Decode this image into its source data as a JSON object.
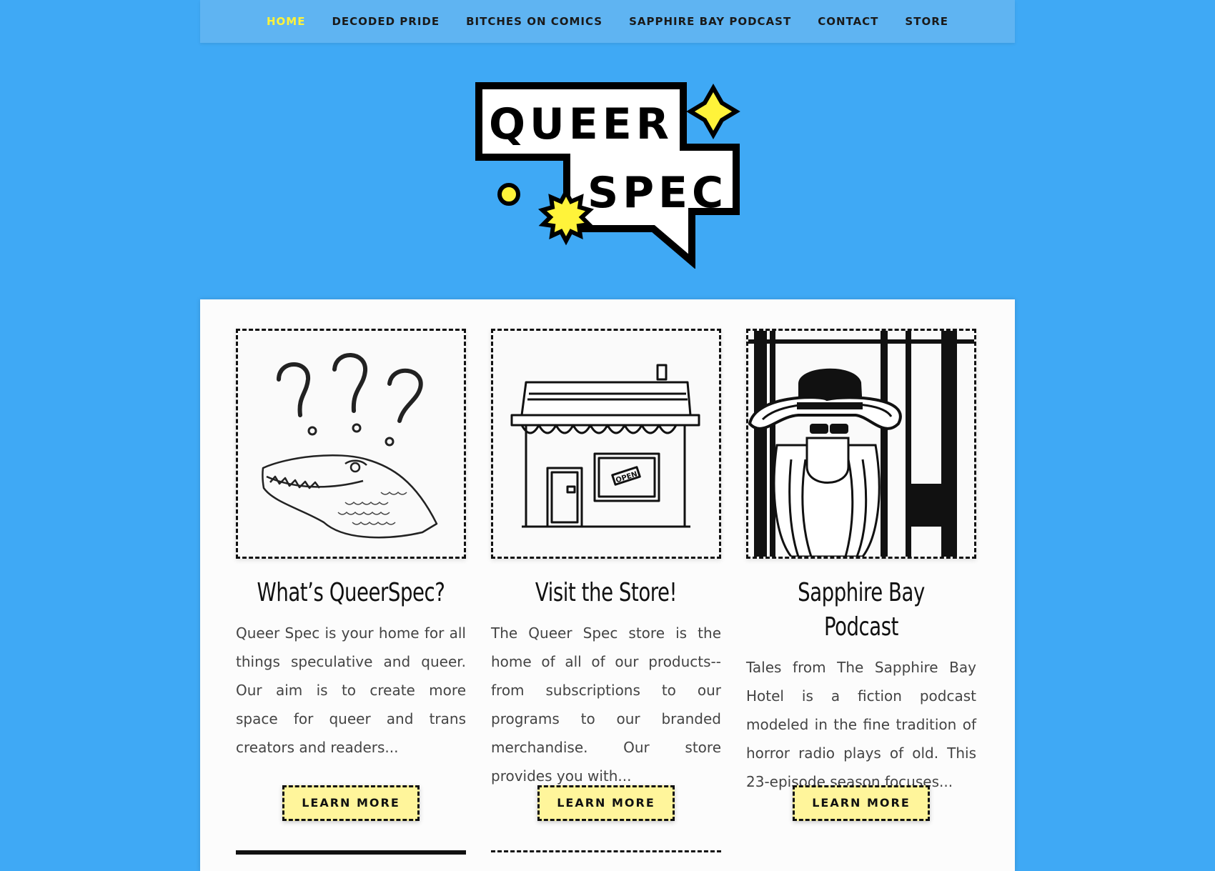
{
  "nav": {
    "items": [
      {
        "label": "HOME",
        "active": true
      },
      {
        "label": "DECODED PRIDE",
        "active": false
      },
      {
        "label": "BITCHES ON COMICS",
        "active": false
      },
      {
        "label": "SAPPHIRE BAY PODCAST",
        "active": false
      },
      {
        "label": "CONTACT",
        "active": false
      },
      {
        "label": "STORE",
        "active": false
      }
    ],
    "active_color": "#fff33a"
  },
  "logo": {
    "line1": "QUEER",
    "line2": "SPEC"
  },
  "colors": {
    "background": "#3fa9f5",
    "nav_bg": "#5fb4f2",
    "button_bg": "#fff59b",
    "accent_yellow": "#fff33a"
  },
  "cards": [
    {
      "title": "What’s QueerSpec?",
      "text": "Queer Spec is your home for all things speculative and queer. Our aim is to create more space for queer and trans creators and readers...",
      "button": "LEARN MORE",
      "image": "question-marks-alligator-drawing"
    },
    {
      "title": "Visit the Store!",
      "text": "The Queer Spec store is the home of all of our products--from subscriptions to our programs to our branded merchandise. Our store provides you with...",
      "button": "LEARN MORE",
      "image": "storefront-drawing",
      "sign": "OPEN"
    },
    {
      "title": "Sapphire Bay Podcast",
      "text": "Tales from The Sapphire Bay Hotel is a fiction podcast modeled in the fine tradition of horror radio plays of old. This 23-episode season focuses...",
      "button": "LEARN MORE",
      "image": "woman-in-sunhat-drawing"
    }
  ]
}
